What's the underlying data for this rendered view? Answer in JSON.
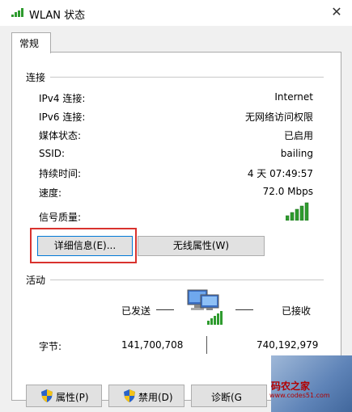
{
  "window": {
    "title": "WLAN 状态",
    "close_glyph": "✕",
    "icon": "wifi-signal-icon"
  },
  "tabs": [
    {
      "label": "常规"
    }
  ],
  "connection": {
    "section_label": "连接",
    "rows": [
      {
        "label": "IPv4 连接:",
        "value": "Internet"
      },
      {
        "label": "IPv6 连接:",
        "value": "无网络访问权限"
      },
      {
        "label": "媒体状态:",
        "value": "已启用"
      },
      {
        "label": "SSID:",
        "value": "bailing"
      },
      {
        "label": "持续时间:",
        "value": "4 天 07:49:57"
      },
      {
        "label": "速度:",
        "value": "72.0 Mbps"
      }
    ],
    "signal_label": "信号质量:",
    "signal_bars": 5,
    "details_button": "详细信息(E)...",
    "wireless_button": "无线属性(W)",
    "highlight_color": "#d9322e"
  },
  "activity": {
    "section_label": "活动",
    "sent_label": "已发送",
    "received_label": "已接收",
    "bytes_label": "字节:",
    "bytes_sent": "141,700,708",
    "bytes_received": "740,192,979"
  },
  "footer": {
    "properties_button": "属性(P)",
    "disable_button": "禁用(D)",
    "diagnose_button": "诊断(G"
  },
  "watermark": {
    "title": "码农之家",
    "url": "www.codes51.com"
  },
  "colors": {
    "signal_green": "#2e9b2e",
    "focus_blue": "#0078d7"
  }
}
